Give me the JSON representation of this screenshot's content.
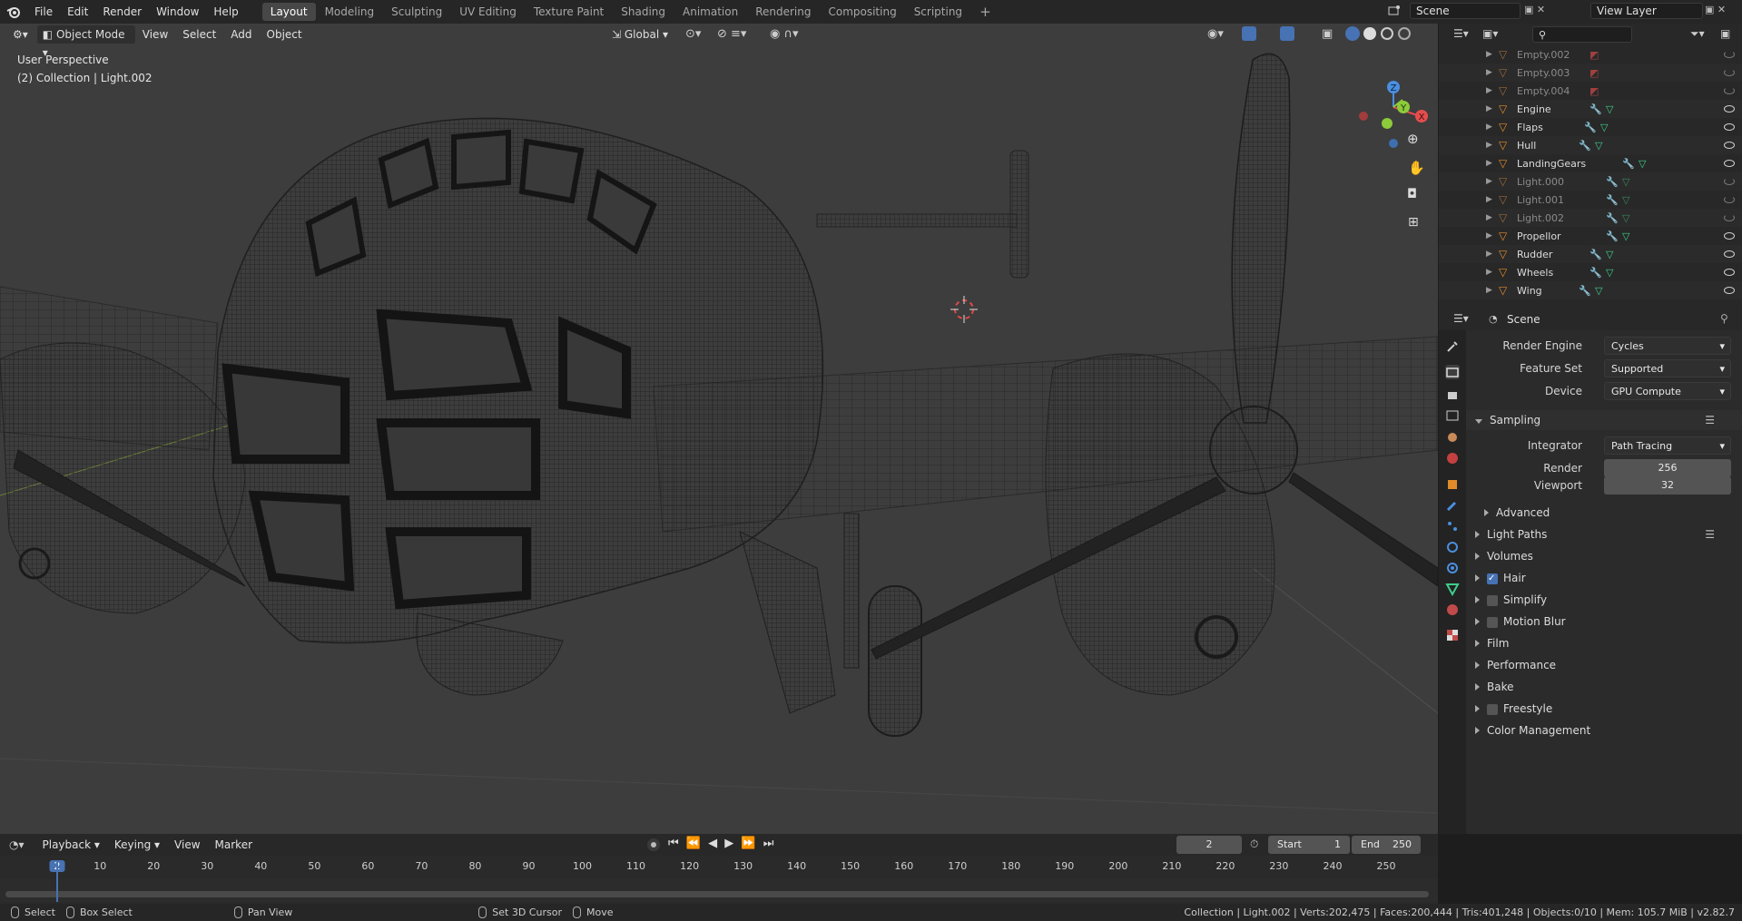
{
  "app": {
    "name": "Blender",
    "version": "v2.82.7"
  },
  "topbar": {
    "menus": [
      "File",
      "Edit",
      "Render",
      "Window",
      "Help"
    ],
    "workspaces": [
      "Layout",
      "Modeling",
      "Sculpting",
      "UV Editing",
      "Texture Paint",
      "Shading",
      "Animation",
      "Rendering",
      "Compositing",
      "Scripting"
    ],
    "active_workspace": "Layout",
    "add_tab": "+",
    "scene": "Scene",
    "view_layer": "View Layer"
  },
  "viewport": {
    "mode": "Object Mode",
    "menus": [
      "View",
      "Select",
      "Add",
      "Object"
    ],
    "transform_orientation": "Global",
    "view_label": "User Perspective",
    "collection_label": "(2) Collection | Light.002",
    "gizmo_axes": {
      "x": "X",
      "y": "Y",
      "z": "Z"
    },
    "colors": {
      "background": "#3d3d3d",
      "wire": "#222222",
      "x_axis": "#e54d4d",
      "y_axis": "#8ccb3a",
      "z_axis": "#4a8fe0"
    }
  },
  "outliner": {
    "search_placeholder": "",
    "items": [
      {
        "name": "Empty.002",
        "dim": true,
        "visible": false
      },
      {
        "name": "Empty.003",
        "dim": true,
        "visible": false
      },
      {
        "name": "Empty.004",
        "dim": true,
        "visible": false
      },
      {
        "name": "Engine",
        "dim": false,
        "visible": true
      },
      {
        "name": "Flaps",
        "dim": false,
        "visible": true
      },
      {
        "name": "Hull",
        "dim": false,
        "visible": true
      },
      {
        "name": "LandingGears",
        "dim": false,
        "visible": true
      },
      {
        "name": "Light.000",
        "dim": true,
        "visible": false
      },
      {
        "name": "Light.001",
        "dim": true,
        "visible": false
      },
      {
        "name": "Light.002",
        "dim": true,
        "visible": false
      },
      {
        "name": "Propellor",
        "dim": false,
        "visible": true
      },
      {
        "name": "Rudder",
        "dim": false,
        "visible": true
      },
      {
        "name": "Wheels",
        "dim": false,
        "visible": true
      },
      {
        "name": "Wing",
        "dim": false,
        "visible": true
      }
    ]
  },
  "properties": {
    "context": "Scene",
    "render_engine": {
      "label": "Render Engine",
      "value": "Cycles"
    },
    "feature_set": {
      "label": "Feature Set",
      "value": "Supported"
    },
    "device": {
      "label": "Device",
      "value": "GPU Compute"
    },
    "sampling": {
      "title": "Sampling",
      "integrator_label": "Integrator",
      "integrator": "Path Tracing",
      "render_label": "Render",
      "render": "256",
      "viewport_label": "Viewport",
      "viewport": "32",
      "advanced": "Advanced"
    },
    "panels": [
      {
        "label": "Light Paths",
        "checkbox": null
      },
      {
        "label": "Volumes",
        "checkbox": null
      },
      {
        "label": "Hair",
        "checkbox": true
      },
      {
        "label": "Simplify",
        "checkbox": false
      },
      {
        "label": "Motion Blur",
        "checkbox": false
      },
      {
        "label": "Film",
        "checkbox": null
      },
      {
        "label": "Performance",
        "checkbox": null
      },
      {
        "label": "Bake",
        "checkbox": null
      },
      {
        "label": "Freestyle",
        "checkbox": false
      },
      {
        "label": "Color Management",
        "checkbox": null
      }
    ]
  },
  "timeline": {
    "menus": [
      "Playback",
      "Keying",
      "View",
      "Marker"
    ],
    "current_frame": "2",
    "start_label": "Start",
    "start": "1",
    "end_label": "End",
    "end": "250",
    "ticks": [
      "2",
      "10",
      "20",
      "30",
      "40",
      "50",
      "60",
      "70",
      "80",
      "90",
      "100",
      "110",
      "120",
      "130",
      "140",
      "150",
      "160",
      "170",
      "180",
      "190",
      "200",
      "210",
      "220",
      "230",
      "240",
      "250"
    ]
  },
  "statusbar": {
    "select": "Select",
    "box_select": "Box Select",
    "pan_view": "Pan View",
    "set_cursor": "Set 3D Cursor",
    "move": "Move",
    "stats": "Collection | Light.002 | Verts:202,475 | Faces:200,444 | Tris:401,248 | Objects:0/10 | Mem: 105.7 MiB | v2.82.7"
  }
}
